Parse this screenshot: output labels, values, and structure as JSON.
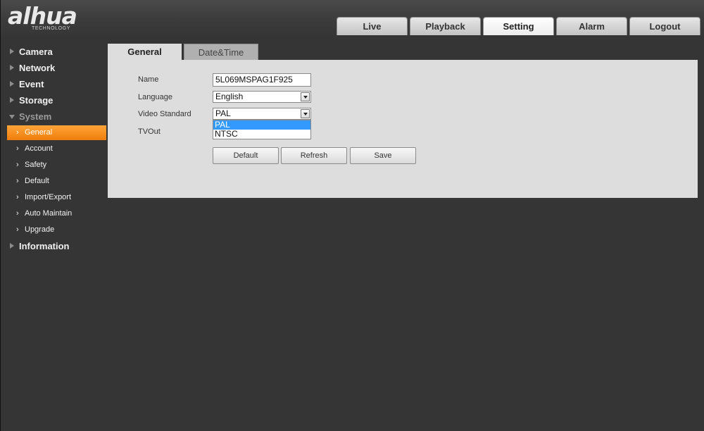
{
  "brand": {
    "logo_text": "alhua",
    "logo_sub": "TECHNOLOGY"
  },
  "nav": {
    "tabs": [
      {
        "label": "Live"
      },
      {
        "label": "Playback"
      },
      {
        "label": "Setting",
        "active": true
      },
      {
        "label": "Alarm"
      },
      {
        "label": "Logout"
      }
    ]
  },
  "sidebar": {
    "camera": "Camera",
    "network": "Network",
    "event": "Event",
    "storage": "Storage",
    "system": "System",
    "sub": [
      {
        "label": "General",
        "active": true
      },
      {
        "label": "Account"
      },
      {
        "label": "Safety"
      },
      {
        "label": "Default"
      },
      {
        "label": "Import/Export"
      },
      {
        "label": "Auto Maintain"
      },
      {
        "label": "Upgrade"
      }
    ],
    "information": "Information"
  },
  "content": {
    "tabs": [
      {
        "label": "General",
        "active": true
      },
      {
        "label": "Date&Time"
      }
    ],
    "form": {
      "name_label": "Name",
      "name_value": "5L069MSPAG1F925",
      "language_label": "Language",
      "language_value": "English",
      "video_standard_label": "Video Standard",
      "video_standard_value": "PAL",
      "video_standard_options": [
        "PAL",
        "NTSC"
      ],
      "video_standard_highlighted": "PAL",
      "tvout_label": "TVOut"
    },
    "buttons": {
      "default": "Default",
      "refresh": "Refresh",
      "save": "Save"
    }
  },
  "colors": {
    "accent": "#f28a16",
    "background": "#353535",
    "panel": "#dddddd",
    "selection": "#3399ff"
  }
}
